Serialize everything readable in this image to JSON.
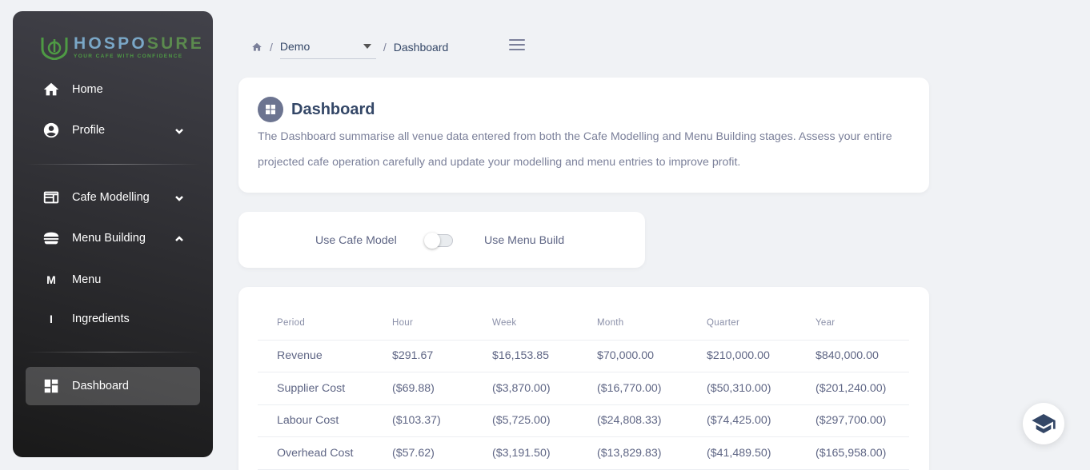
{
  "brand": {
    "name_part1": "HOSPO",
    "name_part2": "SURE",
    "tagline": "YOUR CAFE WITH CONFIDENCE"
  },
  "sidebar": {
    "items": [
      {
        "label": "Home",
        "icon": "home-icon"
      },
      {
        "label": "Profile",
        "icon": "account-circle-icon",
        "expandable": true,
        "expanded": false
      },
      {
        "label": "Cafe Modelling",
        "icon": "newspaper-icon",
        "expandable": true,
        "expanded": false
      },
      {
        "label": "Menu Building",
        "icon": "burger-icon",
        "expandable": true,
        "expanded": true
      },
      {
        "label": "Menu",
        "letter": "M"
      },
      {
        "label": "Ingredients",
        "letter": "I"
      },
      {
        "label": "Dashboard",
        "icon": "dashboard-icon",
        "active": true
      }
    ]
  },
  "breadcrumb": {
    "separator": "/",
    "venue": "Demo",
    "current": "Dashboard"
  },
  "intro": {
    "title": "Dashboard",
    "description": "The Dashboard summarise all venue data entered from both the Cafe Modelling and Menu Building stages. Assess your entire projected cafe operation carefully and update your modelling and menu entries to improve profit."
  },
  "toggle": {
    "left_label": "Use Cafe Model",
    "right_label": "Use Menu Build",
    "on": false
  },
  "table": {
    "headers": [
      "Period",
      "Hour",
      "Week",
      "Month",
      "Quarter",
      "Year"
    ],
    "rows": [
      [
        "Revenue",
        "$291.67",
        "$16,153.85",
        "$70,000.00",
        "$210,000.00",
        "$840,000.00"
      ],
      [
        "Supplier Cost",
        "($69.88)",
        "($3,870.00)",
        "($16,770.00)",
        "($50,310.00)",
        "($201,240.00)"
      ],
      [
        "Labour Cost",
        "($103.37)",
        "($5,725.00)",
        "($24,808.33)",
        "($74,425.00)",
        "($297,700.00)"
      ],
      [
        "Overhead Cost",
        "($57.62)",
        "($3,191.50)",
        "($13,829.83)",
        "($41,489.50)",
        "($165,958.00)"
      ]
    ]
  },
  "colors": {
    "sidebar_top": "#42424a",
    "sidebar_bottom": "#191919",
    "brand_green": "#4e9a44",
    "background": "#f0f2f5"
  }
}
